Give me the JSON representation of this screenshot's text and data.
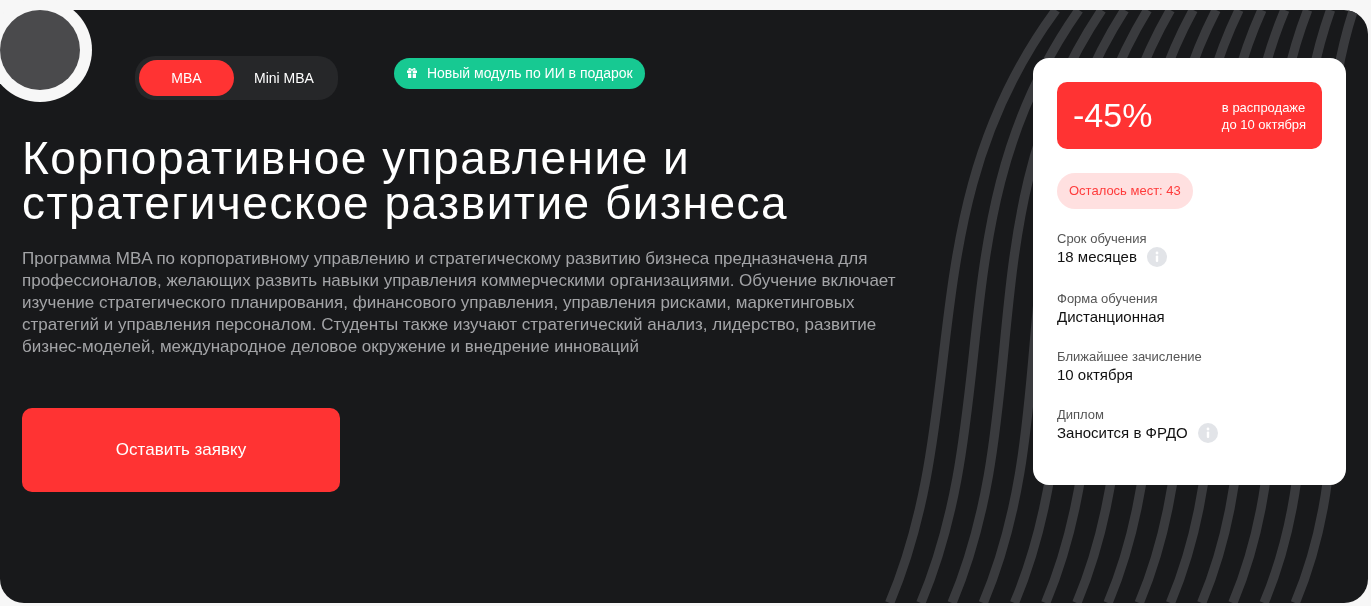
{
  "program_tabs": [
    {
      "label": "MBA",
      "selected": true
    },
    {
      "label": "Mini MBA",
      "selected": false
    }
  ],
  "promo_badge": "Новый модуль по ИИ в подарок",
  "title": "Корпоративное управление и стратегическое развитие бизнеса",
  "description": "Программа MBA по корпоративному управлению и стратегическому развитию бизнеса предназначена для профессионалов, желающих развить навыки управления коммерческими организациями. Обучение включает изучение стратегического планирования, финансового управления, управления рисками, маркетинговых стратегий и управления персоналом. Студенты также изучают стратегический анализ, лидерство, развитие бизнес-моделей, международное деловое окружение и внедрение инноваций",
  "apply_button": "Оставить заявку",
  "offer_card": {
    "discount": "-45%",
    "sale_note": [
      "в распродаже",
      "до 10 октября"
    ],
    "seats_left": "Осталось мест: 43",
    "facts": [
      {
        "label": "Срок обучения",
        "value": "18 месяцев",
        "has_info": true
      },
      {
        "label": "Форма обучения",
        "value": "Дистанционная",
        "has_info": false
      },
      {
        "label": "Ближайшее зачисление",
        "value": "10 октября",
        "has_info": false
      },
      {
        "label": "Диплом",
        "value": "Заносится в ФРДО",
        "has_info": true
      }
    ]
  }
}
